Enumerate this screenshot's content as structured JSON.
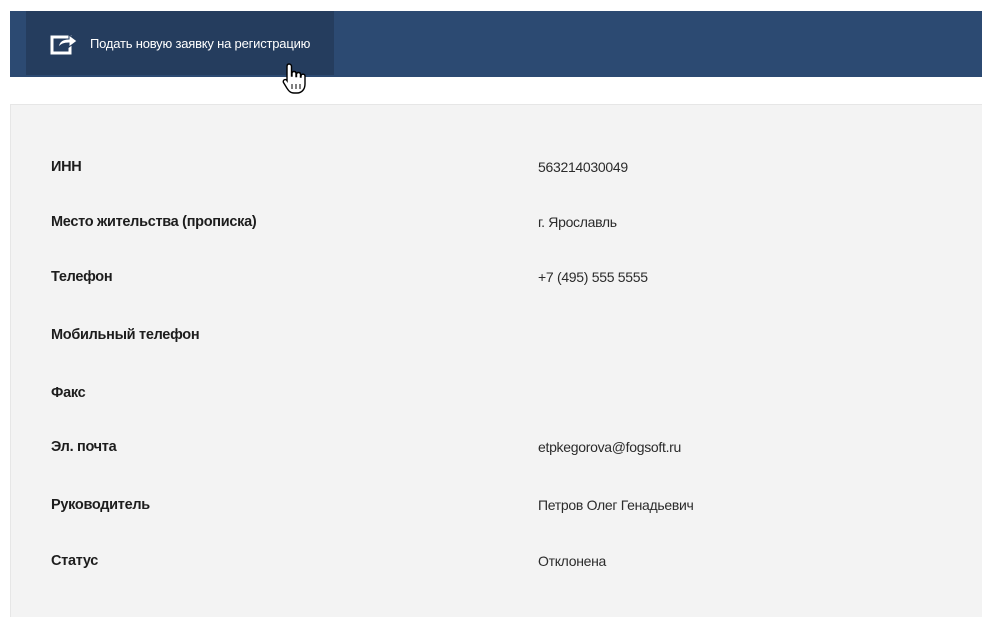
{
  "toolbar": {
    "new_request_label": "Подать новую заявку на регистрацию",
    "icon": "share-box-icon"
  },
  "colors": {
    "topbar": "#2c4a72",
    "button": "#253d5e",
    "panel": "#f3f3f3"
  },
  "details": [
    {
      "label": "ИНН",
      "value": "563214030049"
    },
    {
      "label": "Место жительства (прописка)",
      "value": "г. Ярославль"
    },
    {
      "label": "Телефон",
      "value": "+7 (495) 555 5555"
    },
    {
      "label": "Мобильный телефон",
      "value": ""
    },
    {
      "label": "Факс",
      "value": ""
    },
    {
      "label": "Эл. почта",
      "value": "etpkegorova@fogsoft.ru"
    },
    {
      "label": "Руководитель",
      "value": "Петров Олег Генадьевич"
    },
    {
      "label": "Статус",
      "value": "Отклонена"
    }
  ]
}
